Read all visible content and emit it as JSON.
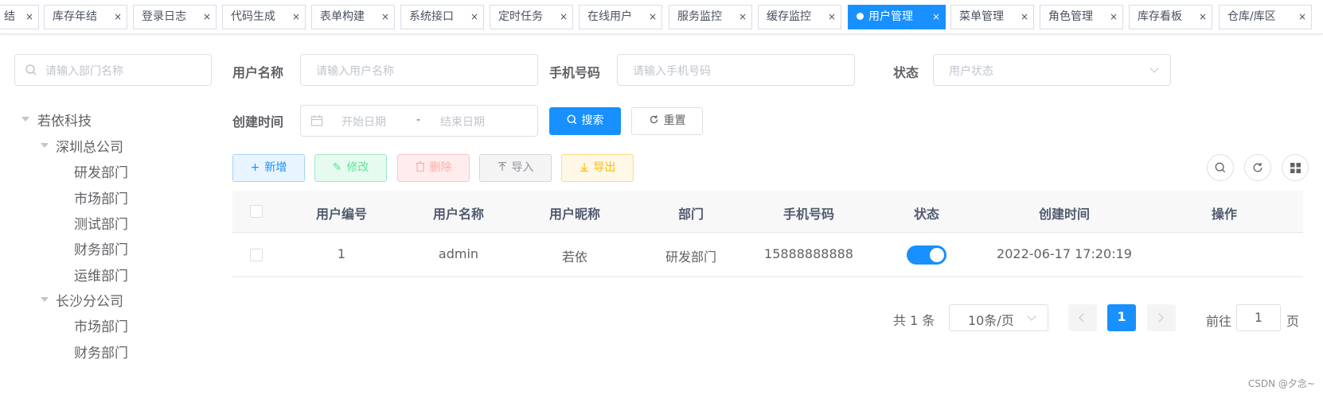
{
  "tabs": [
    {
      "label": "结",
      "active": false
    },
    {
      "label": "库存年结",
      "active": false
    },
    {
      "label": "登录日志",
      "active": false
    },
    {
      "label": "代码生成",
      "active": false
    },
    {
      "label": "表单构建",
      "active": false
    },
    {
      "label": "系统接口",
      "active": false
    },
    {
      "label": "定时任务",
      "active": false
    },
    {
      "label": "在线用户",
      "active": false
    },
    {
      "label": "服务监控",
      "active": false
    },
    {
      "label": "缓存监控",
      "active": false
    },
    {
      "label": "用户管理",
      "active": true
    },
    {
      "label": "菜单管理",
      "active": false
    },
    {
      "label": "角色管理",
      "active": false
    },
    {
      "label": "库存看板",
      "active": false
    },
    {
      "label": "仓库/库区",
      "active": false
    }
  ],
  "tab_close_glyph": "×",
  "dept_search": {
    "placeholder": "请输入部门名称"
  },
  "dept_tree": [
    {
      "label": "若依科技",
      "level": 0,
      "expanded": true
    },
    {
      "label": "深圳总公司",
      "level": 1,
      "expanded": true
    },
    {
      "label": "研发部门",
      "level": 2
    },
    {
      "label": "市场部门",
      "level": 2
    },
    {
      "label": "测试部门",
      "level": 2
    },
    {
      "label": "财务部门",
      "level": 2
    },
    {
      "label": "运维部门",
      "level": 2
    },
    {
      "label": "长沙分公司",
      "level": 1,
      "expanded": true
    },
    {
      "label": "市场部门",
      "level": 2
    },
    {
      "label": "财务部门",
      "level": 2
    }
  ],
  "filters": {
    "username_label": "用户名称",
    "username_placeholder": "请输入用户名称",
    "phone_label": "手机号码",
    "phone_placeholder": "请输入手机号码",
    "status_label": "状态",
    "status_placeholder": "用户状态",
    "created_label": "创建时间",
    "start_placeholder": "开始日期",
    "date_separator": "-",
    "end_placeholder": "结束日期",
    "search_button": "搜索",
    "reset_button": "重置"
  },
  "toolbar": {
    "add": "新增",
    "edit": "修改",
    "delete": "删除",
    "import": "导入",
    "export": "导出"
  },
  "table": {
    "columns": [
      "用户编号",
      "用户名称",
      "用户昵称",
      "部门",
      "手机号码",
      "状态",
      "创建时间",
      "操作"
    ],
    "rows": [
      {
        "id": "1",
        "username": "admin",
        "nickname": "若依",
        "dept": "研发部门",
        "phone": "15888888888",
        "status_on": true,
        "created": "2022-06-17 17:20:19"
      }
    ]
  },
  "pagination": {
    "total_text": "共 1 条",
    "page_size": "10条/页",
    "current_page": "1",
    "goto_prefix": "前往",
    "goto_value": "1",
    "goto_suffix": "页"
  },
  "watermark": "CSDN @夕念~",
  "colors": {
    "primary": "#1890ff",
    "success": "#5be69b",
    "danger": "#ffaaaa",
    "warning": "#ffba00",
    "info": "#909399"
  }
}
